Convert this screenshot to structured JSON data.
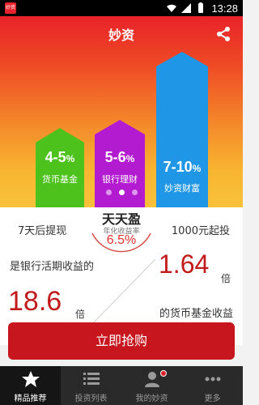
{
  "status_bar": {
    "app_icon_text": "妙资",
    "time": "13:28"
  },
  "header": {
    "title": "妙资"
  },
  "products": [
    {
      "value_main": "4-5",
      "value_unit": "%",
      "label": "货币基金",
      "color": "#4dc21c"
    },
    {
      "value_main": "5-6",
      "value_unit": "%",
      "label": "银行理财",
      "color": "#b21bd0"
    },
    {
      "value_main": "7-10",
      "value_unit": "%",
      "label": "妙资财富",
      "color": "#1f97e6"
    }
  ],
  "carousel": {
    "pages": 3,
    "active_index": 1
  },
  "card": {
    "left_note": "7天后提现",
    "right_note": "1000元起投",
    "product_name": "天天盈",
    "rate_label": "年化收益率",
    "rate_value": "6.5%",
    "compare_bank_text": "是银行活期收益的",
    "compare_bank_value": "18.6",
    "compare_bank_unit": "倍",
    "compare_fund_value": "1.64",
    "compare_fund_unit": "倍",
    "compare_fund_text": "的货币基金收益"
  },
  "cta": {
    "label": "立即抢购"
  },
  "tabs": [
    {
      "label": "精品推荐",
      "icon": "star-icon"
    },
    {
      "label": "投资列表",
      "icon": "list-icon"
    },
    {
      "label": "我的妙资",
      "icon": "user-icon"
    },
    {
      "label": "更多",
      "icon": "more-icon"
    }
  ],
  "colors": {
    "accent_red": "#c7161d",
    "highlight_red": "#c21b1b",
    "rate_red": "#e23130"
  }
}
